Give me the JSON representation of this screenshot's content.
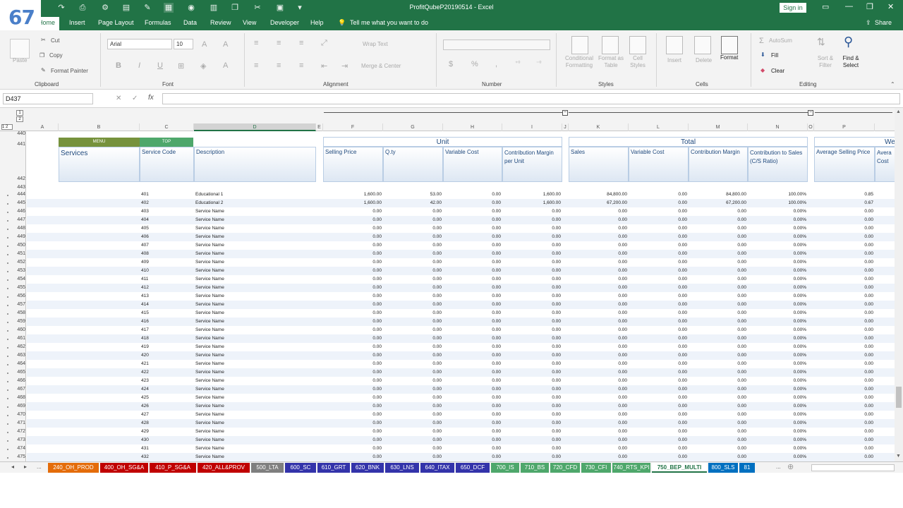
{
  "window": {
    "title": "ProfitQubeP20190514  -  Excel",
    "signin": "Sign in",
    "share": "Share",
    "badge": "67"
  },
  "menu": {
    "tabs": [
      "Home",
      "Insert",
      "Page Layout",
      "Formulas",
      "Data",
      "Review",
      "View",
      "Developer",
      "Help"
    ],
    "tell_me": "Tell me what you want to do"
  },
  "ribbon": {
    "clipboard": {
      "paste": "Paste",
      "cut": "Cut",
      "copy": "Copy",
      "painter": "Format Painter",
      "group": "Clipboard"
    },
    "font": {
      "name": "Arial",
      "size": "10",
      "group": "Font"
    },
    "alignment": {
      "wrap": "Wrap Text",
      "merge": "Merge & Center",
      "group": "Alignment"
    },
    "number": {
      "group": "Number"
    },
    "styles": {
      "cond": "Conditional Formatting",
      "table": "Format as Table",
      "cell": "Cell Styles",
      "group": "Styles"
    },
    "cells": {
      "insert": "Insert",
      "delete": "Delete",
      "format": "Format",
      "group": "Cells"
    },
    "editing": {
      "autosum": "AutoSum",
      "fill": "Fill",
      "clear": "Clear",
      "sort": "Sort & Filter",
      "find": "Find & Select",
      "group": "Editing"
    }
  },
  "formula_bar": {
    "name_box": "D437",
    "content": ""
  },
  "columns": [
    "A",
    "B",
    "C",
    "D",
    "E",
    "F",
    "G",
    "H",
    "I",
    "J",
    "K",
    "L",
    "M",
    "N",
    "O",
    "P"
  ],
  "sheet": {
    "menu_btn": "MENU",
    "top_btn": "TOP",
    "services": "Services",
    "service_code": "Service Code",
    "description": "Description",
    "unit_group": "Unit",
    "total_group": "Total",
    "weighted_group": "Wei",
    "unit_headers": [
      "Selling Price",
      "Q.ty",
      "Variable Cost",
      "Contribution Margin per Unit"
    ],
    "total_headers": [
      "Sales",
      "Variable Cost",
      "Contribution Margin",
      "Contribution to Sales (C/S Ratio)"
    ],
    "weighted_headers": [
      "Average Selling Price",
      "Avera Cost"
    ],
    "header_rows": [
      "440",
      "441",
      "442",
      "443"
    ],
    "rows": [
      {
        "n": "444",
        "code": "401",
        "desc": "Educational 1",
        "sp": "1,600.00",
        "qty": "53.00",
        "vc": "0.00",
        "cm": "1,600.00",
        "sales": "84,800.00",
        "tvc": "0.00",
        "tcm": "84,800.00",
        "cs": "100.00%",
        "asp": "0.85"
      },
      {
        "n": "445",
        "code": "402",
        "desc": "Educational 2",
        "sp": "1,600.00",
        "qty": "42.00",
        "vc": "0.00",
        "cm": "1,600.00",
        "sales": "67,200.00",
        "tvc": "0.00",
        "tcm": "67,200.00",
        "cs": "100.00%",
        "asp": "0.67"
      },
      {
        "n": "446",
        "code": "403",
        "desc": "Service Name",
        "sp": "0.00",
        "qty": "0.00",
        "vc": "0.00",
        "cm": "0.00",
        "sales": "0.00",
        "tvc": "0.00",
        "tcm": "0.00",
        "cs": "0.00%",
        "asp": "0.00"
      },
      {
        "n": "447",
        "code": "404",
        "desc": "Service Name",
        "sp": "0.00",
        "qty": "0.00",
        "vc": "0.00",
        "cm": "0.00",
        "sales": "0.00",
        "tvc": "0.00",
        "tcm": "0.00",
        "cs": "0.00%",
        "asp": "0.00"
      },
      {
        "n": "448",
        "code": "405",
        "desc": "Service Name",
        "sp": "0.00",
        "qty": "0.00",
        "vc": "0.00",
        "cm": "0.00",
        "sales": "0.00",
        "tvc": "0.00",
        "tcm": "0.00",
        "cs": "0.00%",
        "asp": "0.00"
      },
      {
        "n": "449",
        "code": "406",
        "desc": "Service Name",
        "sp": "0.00",
        "qty": "0.00",
        "vc": "0.00",
        "cm": "0.00",
        "sales": "0.00",
        "tvc": "0.00",
        "tcm": "0.00",
        "cs": "0.00%",
        "asp": "0.00"
      },
      {
        "n": "450",
        "code": "407",
        "desc": "Service Name",
        "sp": "0.00",
        "qty": "0.00",
        "vc": "0.00",
        "cm": "0.00",
        "sales": "0.00",
        "tvc": "0.00",
        "tcm": "0.00",
        "cs": "0.00%",
        "asp": "0.00"
      },
      {
        "n": "451",
        "code": "408",
        "desc": "Service Name",
        "sp": "0.00",
        "qty": "0.00",
        "vc": "0.00",
        "cm": "0.00",
        "sales": "0.00",
        "tvc": "0.00",
        "tcm": "0.00",
        "cs": "0.00%",
        "asp": "0.00"
      },
      {
        "n": "452",
        "code": "409",
        "desc": "Service Name",
        "sp": "0.00",
        "qty": "0.00",
        "vc": "0.00",
        "cm": "0.00",
        "sales": "0.00",
        "tvc": "0.00",
        "tcm": "0.00",
        "cs": "0.00%",
        "asp": "0.00"
      },
      {
        "n": "453",
        "code": "410",
        "desc": "Service Name",
        "sp": "0.00",
        "qty": "0.00",
        "vc": "0.00",
        "cm": "0.00",
        "sales": "0.00",
        "tvc": "0.00",
        "tcm": "0.00",
        "cs": "0.00%",
        "asp": "0.00"
      },
      {
        "n": "454",
        "code": "411",
        "desc": "Service Name",
        "sp": "0.00",
        "qty": "0.00",
        "vc": "0.00",
        "cm": "0.00",
        "sales": "0.00",
        "tvc": "0.00",
        "tcm": "0.00",
        "cs": "0.00%",
        "asp": "0.00"
      },
      {
        "n": "455",
        "code": "412",
        "desc": "Service Name",
        "sp": "0.00",
        "qty": "0.00",
        "vc": "0.00",
        "cm": "0.00",
        "sales": "0.00",
        "tvc": "0.00",
        "tcm": "0.00",
        "cs": "0.00%",
        "asp": "0.00"
      },
      {
        "n": "456",
        "code": "413",
        "desc": "Service Name",
        "sp": "0.00",
        "qty": "0.00",
        "vc": "0.00",
        "cm": "0.00",
        "sales": "0.00",
        "tvc": "0.00",
        "tcm": "0.00",
        "cs": "0.00%",
        "asp": "0.00"
      },
      {
        "n": "457",
        "code": "414",
        "desc": "Service Name",
        "sp": "0.00",
        "qty": "0.00",
        "vc": "0.00",
        "cm": "0.00",
        "sales": "0.00",
        "tvc": "0.00",
        "tcm": "0.00",
        "cs": "0.00%",
        "asp": "0.00"
      },
      {
        "n": "458",
        "code": "415",
        "desc": "Service Name",
        "sp": "0.00",
        "qty": "0.00",
        "vc": "0.00",
        "cm": "0.00",
        "sales": "0.00",
        "tvc": "0.00",
        "tcm": "0.00",
        "cs": "0.00%",
        "asp": "0.00"
      },
      {
        "n": "459",
        "code": "416",
        "desc": "Service Name",
        "sp": "0.00",
        "qty": "0.00",
        "vc": "0.00",
        "cm": "0.00",
        "sales": "0.00",
        "tvc": "0.00",
        "tcm": "0.00",
        "cs": "0.00%",
        "asp": "0.00"
      },
      {
        "n": "460",
        "code": "417",
        "desc": "Service Name",
        "sp": "0.00",
        "qty": "0.00",
        "vc": "0.00",
        "cm": "0.00",
        "sales": "0.00",
        "tvc": "0.00",
        "tcm": "0.00",
        "cs": "0.00%",
        "asp": "0.00"
      },
      {
        "n": "461",
        "code": "418",
        "desc": "Service Name",
        "sp": "0.00",
        "qty": "0.00",
        "vc": "0.00",
        "cm": "0.00",
        "sales": "0.00",
        "tvc": "0.00",
        "tcm": "0.00",
        "cs": "0.00%",
        "asp": "0.00"
      },
      {
        "n": "462",
        "code": "419",
        "desc": "Service Name",
        "sp": "0.00",
        "qty": "0.00",
        "vc": "0.00",
        "cm": "0.00",
        "sales": "0.00",
        "tvc": "0.00",
        "tcm": "0.00",
        "cs": "0.00%",
        "asp": "0.00"
      },
      {
        "n": "463",
        "code": "420",
        "desc": "Service Name",
        "sp": "0.00",
        "qty": "0.00",
        "vc": "0.00",
        "cm": "0.00",
        "sales": "0.00",
        "tvc": "0.00",
        "tcm": "0.00",
        "cs": "0.00%",
        "asp": "0.00"
      },
      {
        "n": "464",
        "code": "421",
        "desc": "Service Name",
        "sp": "0.00",
        "qty": "0.00",
        "vc": "0.00",
        "cm": "0.00",
        "sales": "0.00",
        "tvc": "0.00",
        "tcm": "0.00",
        "cs": "0.00%",
        "asp": "0.00"
      },
      {
        "n": "465",
        "code": "422",
        "desc": "Service Name",
        "sp": "0.00",
        "qty": "0.00",
        "vc": "0.00",
        "cm": "0.00",
        "sales": "0.00",
        "tvc": "0.00",
        "tcm": "0.00",
        "cs": "0.00%",
        "asp": "0.00"
      },
      {
        "n": "466",
        "code": "423",
        "desc": "Service Name",
        "sp": "0.00",
        "qty": "0.00",
        "vc": "0.00",
        "cm": "0.00",
        "sales": "0.00",
        "tvc": "0.00",
        "tcm": "0.00",
        "cs": "0.00%",
        "asp": "0.00"
      },
      {
        "n": "467",
        "code": "424",
        "desc": "Service Name",
        "sp": "0.00",
        "qty": "0.00",
        "vc": "0.00",
        "cm": "0.00",
        "sales": "0.00",
        "tvc": "0.00",
        "tcm": "0.00",
        "cs": "0.00%",
        "asp": "0.00"
      },
      {
        "n": "468",
        "code": "425",
        "desc": "Service Name",
        "sp": "0.00",
        "qty": "0.00",
        "vc": "0.00",
        "cm": "0.00",
        "sales": "0.00",
        "tvc": "0.00",
        "tcm": "0.00",
        "cs": "0.00%",
        "asp": "0.00"
      },
      {
        "n": "469",
        "code": "426",
        "desc": "Service Name",
        "sp": "0.00",
        "qty": "0.00",
        "vc": "0.00",
        "cm": "0.00",
        "sales": "0.00",
        "tvc": "0.00",
        "tcm": "0.00",
        "cs": "0.00%",
        "asp": "0.00"
      },
      {
        "n": "470",
        "code": "427",
        "desc": "Service Name",
        "sp": "0.00",
        "qty": "0.00",
        "vc": "0.00",
        "cm": "0.00",
        "sales": "0.00",
        "tvc": "0.00",
        "tcm": "0.00",
        "cs": "0.00%",
        "asp": "0.00"
      },
      {
        "n": "471",
        "code": "428",
        "desc": "Service Name",
        "sp": "0.00",
        "qty": "0.00",
        "vc": "0.00",
        "cm": "0.00",
        "sales": "0.00",
        "tvc": "0.00",
        "tcm": "0.00",
        "cs": "0.00%",
        "asp": "0.00"
      },
      {
        "n": "472",
        "code": "429",
        "desc": "Service Name",
        "sp": "0.00",
        "qty": "0.00",
        "vc": "0.00",
        "cm": "0.00",
        "sales": "0.00",
        "tvc": "0.00",
        "tcm": "0.00",
        "cs": "0.00%",
        "asp": "0.00"
      },
      {
        "n": "473",
        "code": "430",
        "desc": "Service Name",
        "sp": "0.00",
        "qty": "0.00",
        "vc": "0.00",
        "cm": "0.00",
        "sales": "0.00",
        "tvc": "0.00",
        "tcm": "0.00",
        "cs": "0.00%",
        "asp": "0.00"
      },
      {
        "n": "474",
        "code": "431",
        "desc": "Service Name",
        "sp": "0.00",
        "qty": "0.00",
        "vc": "0.00",
        "cm": "0.00",
        "sales": "0.00",
        "tvc": "0.00",
        "tcm": "0.00",
        "cs": "0.00%",
        "asp": "0.00"
      },
      {
        "n": "475",
        "code": "432",
        "desc": "Service Name",
        "sp": "0.00",
        "qty": "0.00",
        "vc": "0.00",
        "cm": "0.00",
        "sales": "0.00",
        "tvc": "0.00",
        "tcm": "0.00",
        "cs": "0.00%",
        "asp": "0.00"
      }
    ]
  },
  "sheet_tabs": [
    {
      "label": "240_OH_PROD",
      "color": "#e46c0a"
    },
    {
      "label": "400_OH_SG&A",
      "color": "#c00000"
    },
    {
      "label": "410_P_SG&A",
      "color": "#c00000"
    },
    {
      "label": "420_ALL&PROV",
      "color": "#c00000"
    },
    {
      "label": "500_LTA",
      "color": "#7f7f7f"
    },
    {
      "label": "600_SC",
      "color": "#3333aa"
    },
    {
      "label": "610_GRT",
      "color": "#3333aa"
    },
    {
      "label": "620_BNK",
      "color": "#3333aa"
    },
    {
      "label": "630_LNS",
      "color": "#3333aa"
    },
    {
      "label": "640_ITAX",
      "color": "#3333aa"
    },
    {
      "label": "650_DCF",
      "color": "#3333aa"
    },
    {
      "label": "700_IS",
      "color": "#4ea76b"
    },
    {
      "label": "710_BS",
      "color": "#4ea76b"
    },
    {
      "label": "720_CFD",
      "color": "#4ea76b"
    },
    {
      "label": "730_CFI",
      "color": "#4ea76b"
    },
    {
      "label": "740_RTS_KPI",
      "color": "#4ea76b"
    },
    {
      "label": "750_BEP_MULTI",
      "color": "#ffffff"
    },
    {
      "label": "800_SLS",
      "color": "#0070c0"
    },
    {
      "label": "81",
      "color": "#0070c0"
    }
  ],
  "colors": {
    "excel_green": "#217346",
    "header_blue": "#1f497d",
    "menu_btn": "#76923c",
    "top_btn": "#4ea76b"
  }
}
